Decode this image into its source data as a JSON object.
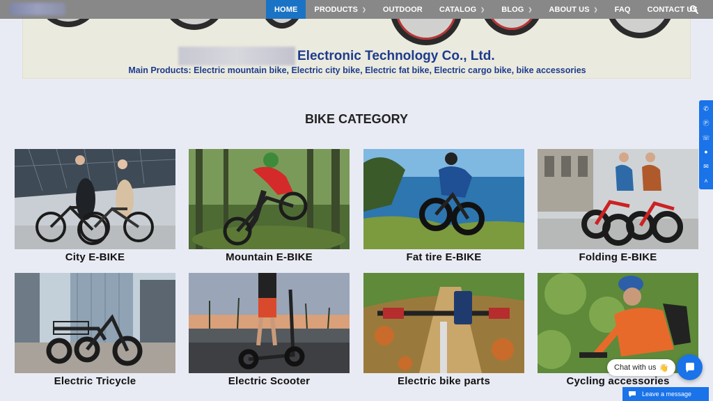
{
  "nav": {
    "items": [
      {
        "label": "HOME",
        "active": true,
        "dropdown": false
      },
      {
        "label": "PRODUCTS",
        "active": false,
        "dropdown": true
      },
      {
        "label": "OUTDOOR",
        "active": false,
        "dropdown": false
      },
      {
        "label": "CATALOG",
        "active": false,
        "dropdown": true
      },
      {
        "label": "BLOG",
        "active": false,
        "dropdown": true
      },
      {
        "label": "ABOUT US",
        "active": false,
        "dropdown": true
      },
      {
        "label": "FAQ",
        "active": false,
        "dropdown": false
      },
      {
        "label": "CONTACT US",
        "active": false,
        "dropdown": false
      }
    ],
    "search_icon": "search-icon"
  },
  "banner": {
    "company_name": "Electronic Technology Co., Ltd.",
    "main_products": "Main Products: Electric mountain bike, Electric city bike, Electric fat bike, Electric cargo bike, bike accessories"
  },
  "section": {
    "title": "BIKE CATEGORY"
  },
  "categories": [
    {
      "label": "City E-BIKE"
    },
    {
      "label": "Mountain E-BIKE"
    },
    {
      "label": "Fat tire E-BIKE"
    },
    {
      "label": "Folding E-BIKE"
    },
    {
      "label": "Electric Tricycle"
    },
    {
      "label": "Electric Scooter"
    },
    {
      "label": "Electric bike parts"
    },
    {
      "label": "Cycling accessories"
    }
  ],
  "social_icons": [
    "phone-icon",
    "skype-icon",
    "whatsapp-icon",
    "wechat-icon",
    "email-icon",
    "scroll-up-icon"
  ],
  "chat": {
    "bubble_text": "Chat with us",
    "bubble_emoji": "👋",
    "leave_message": "Leave a message"
  },
  "colors": {
    "accent": "#1a73e8",
    "nav_active": "#1a73c4",
    "company_text": "#1d3b8c",
    "page_bg": "#e9ebf4"
  }
}
